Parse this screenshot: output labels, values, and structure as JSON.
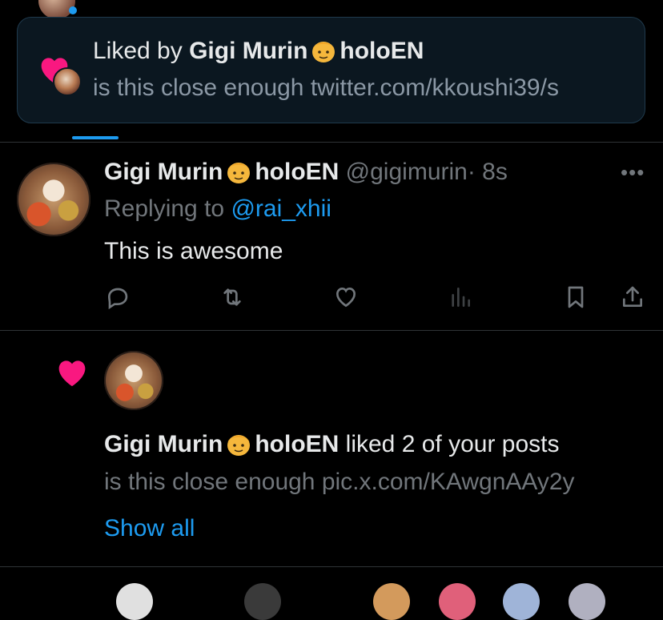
{
  "toast": {
    "liked_by_prefix": "Liked by ",
    "name": "Gigi Murin",
    "name_suffix": "holoEN",
    "preview": "is this close enough twitter.com/kkoushi39/s"
  },
  "tweet": {
    "name": "Gigi Murin",
    "name_suffix": "holoEN",
    "handle": "@gigimurin",
    "time": "· 8s",
    "replying_prefix": "Replying to ",
    "replying_to": "@rai_xhii",
    "text": "This is awesome",
    "more_label": "•••"
  },
  "notification": {
    "name": "Gigi Murin",
    "name_suffix": "holoEN",
    "action_text": " liked 2 of your posts",
    "preview": "is this close enough pic.x.com/KAwgnAAy2y",
    "show_all": "Show all"
  },
  "colors": {
    "background": "#000000",
    "accent": "#1d9bf0",
    "heart": "#f91880",
    "muted": "#71767b"
  },
  "icons": [
    "heart-icon",
    "reply-icon",
    "retweet-icon",
    "like-icon",
    "views-icon",
    "bookmark-icon",
    "share-icon",
    "more-icon",
    "emoji-icon"
  ]
}
